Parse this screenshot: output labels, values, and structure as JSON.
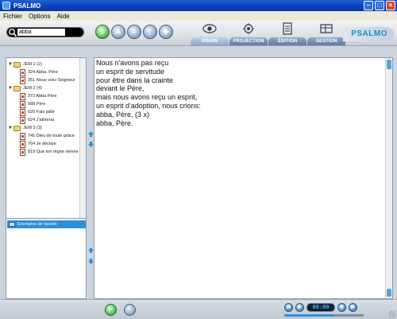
{
  "window": {
    "title": "PSALMO"
  },
  "menu": {
    "items": [
      "Fichier",
      "Options",
      "Aide"
    ]
  },
  "search": {
    "value": "abba",
    "placeholder": ""
  },
  "tabs": [
    {
      "label": "VISION",
      "active": true
    },
    {
      "label": "PROJECTION",
      "active": false
    },
    {
      "label": "ÉDITION",
      "active": false
    },
    {
      "label": "GESTION",
      "active": false
    }
  ],
  "logo": {
    "text": "PSALMO"
  },
  "tree": [
    {
      "label": "JEM 1 (2)",
      "level": 0,
      "expanded": true
    },
    {
      "label": "324 Abba, Père",
      "level": 1
    },
    {
      "label": "351 Nous voici Seigneur",
      "level": 1
    },
    {
      "label": "JEM 2 (4)",
      "level": 0,
      "expanded": true
    },
    {
      "label": "372 Abba Père",
      "level": 1
    },
    {
      "label": "588 Père",
      "level": 1
    },
    {
      "label": "620 Fais jaillir",
      "level": 1
    },
    {
      "label": "624 J'attirerai",
      "level": 1
    },
    {
      "label": "JEM 3 (3)",
      "level": 0,
      "expanded": true
    },
    {
      "label": "745 Dieu de toute grâce",
      "level": 1
    },
    {
      "label": "764 Je déclare",
      "level": 1
    },
    {
      "label": "819 Que ton règne vienne",
      "level": 1
    }
  ],
  "favorites": [
    {
      "label": "Exemples de favoris",
      "selected": true
    }
  ],
  "lyrics": [
    "Nous n'avons pas reçu",
    "un esprit de servitude",
    "pour être dans la crainte",
    "devant le Père,",
    "mais nous avons reçu un esprit,",
    "un esprit d'adoption, nous crions:",
    "abba, Père, (3 x)",
    "abba, Père."
  ],
  "player": {
    "time": "00:00",
    "progress": 0.62
  },
  "colors": {
    "accent": "#2f8fd6",
    "titlebar": "#0a3fb5",
    "selection": "#2f8fd6"
  }
}
